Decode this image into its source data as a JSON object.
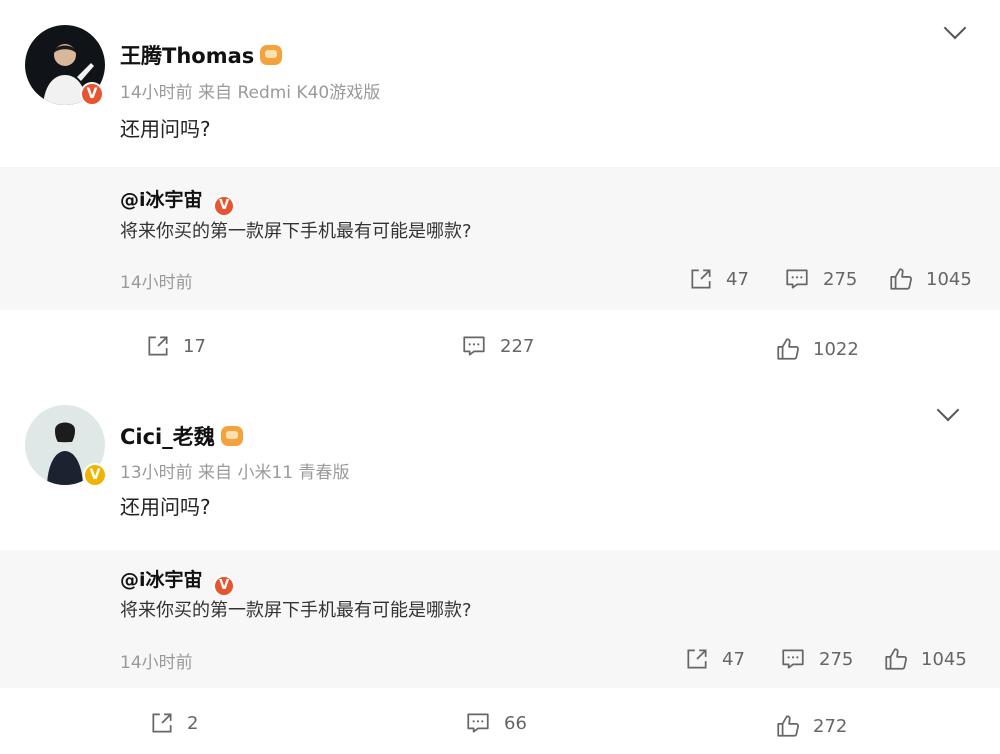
{
  "posts": [
    {
      "username": "王腾Thomas",
      "meta": "14小时前 来自 Redmi K40游戏版",
      "content": "还用问吗?",
      "quote": {
        "author": "@i冰宇宙",
        "text": "将来你买的第一款屏下手机最有可能是哪款?",
        "time": "14小时前",
        "reposts": "47",
        "comments": "275",
        "likes": "1045"
      },
      "reposts": "17",
      "comments": "227",
      "likes": "1022"
    },
    {
      "username": "Cici_老魏",
      "meta": "13小时前 来自 小米11 青春版",
      "content": "还用问吗?",
      "quote": {
        "author": "@i冰宇宙",
        "text": "将来你买的第一款屏下手机最有可能是哪款?",
        "time": "14小时前",
        "reposts": "47",
        "comments": "275",
        "likes": "1045"
      },
      "reposts": "2",
      "comments": "66",
      "likes": "272"
    }
  ],
  "colors": {
    "verified_red": "#e8542f",
    "verified_gold": "#f0b400",
    "quote_bg": "#f7f7f7"
  },
  "icons": [
    "share-icon",
    "comment-icon",
    "like-icon",
    "chevron-down-icon",
    "verified-icon",
    "vip-crown-icon"
  ]
}
